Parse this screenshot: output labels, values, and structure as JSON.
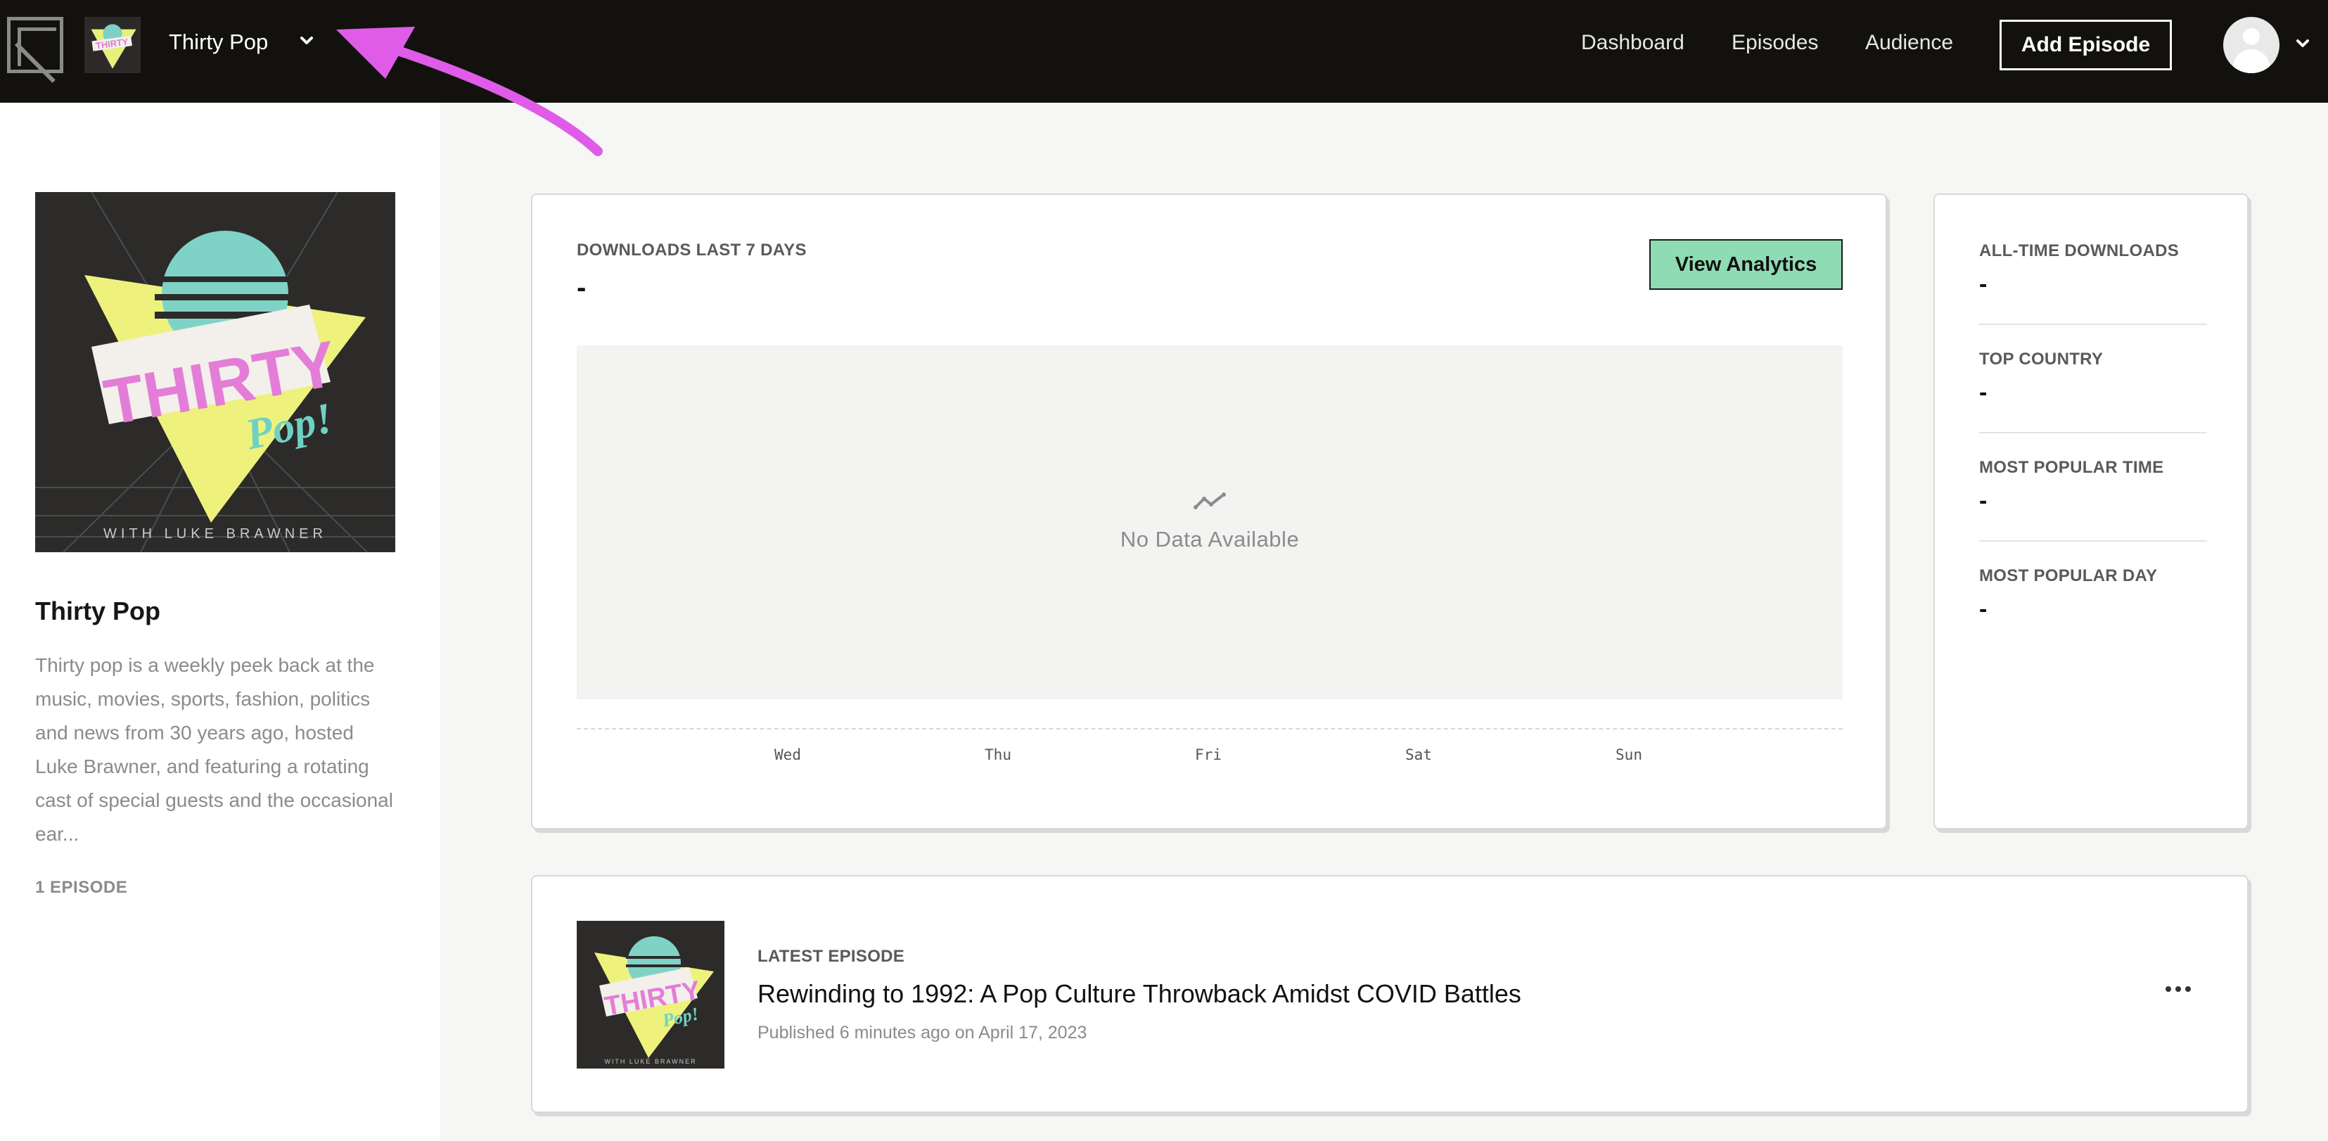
{
  "topbar": {
    "logo_icon": "brand-logo-icon",
    "show_name": "Thirty Pop",
    "show_switch_icon": "chevron-down-icon",
    "nav": {
      "dashboard": "Dashboard",
      "episodes": "Episodes",
      "audience": "Audience"
    },
    "add_episode": "Add Episode",
    "account_icon": "user-avatar-icon",
    "account_menu_icon": "chevron-down-icon"
  },
  "annotation": {
    "arrow_color": "#e05ce8"
  },
  "sidebar": {
    "cover": {
      "title_word": "THIRTY",
      "subtitle_word": "Pop!",
      "byline": "WITH LUKE BRAWNER"
    },
    "title": "Thirty Pop",
    "description": "Thirty pop is a weekly peek back at the music, movies, sports, fashion, politics and news from 30 years ago, hosted Luke Brawner, and featuring a rotating cast of special guests and the occasional ear...",
    "episode_count": "1 EPISODE"
  },
  "downloads": {
    "label": "DOWNLOADS LAST 7 DAYS",
    "value": "-",
    "view_analytics": "View Analytics",
    "empty_icon": "trend-line-icon",
    "empty_text": "No Data Available",
    "days": [
      "Wed",
      "Thu",
      "Fri",
      "Sat",
      "Sun"
    ]
  },
  "stats": [
    {
      "label": "ALL-TIME DOWNLOADS",
      "value": "-"
    },
    {
      "label": "TOP COUNTRY",
      "value": "-"
    },
    {
      "label": "MOST POPULAR TIME",
      "value": "-"
    },
    {
      "label": "MOST POPULAR DAY",
      "value": "-"
    }
  ],
  "latest_episode": {
    "label": "LATEST EPISODE",
    "title": "Rewinding to 1992: A Pop Culture Throwback Amidst COVID Battles",
    "published": "Published 6 minutes ago on April 17, 2023",
    "menu_icon": "more-horizontal-icon"
  },
  "colors": {
    "topbar_bg": "#12110e",
    "accent_green": "#8fdcb4",
    "page_bg": "#f6f6f5"
  }
}
